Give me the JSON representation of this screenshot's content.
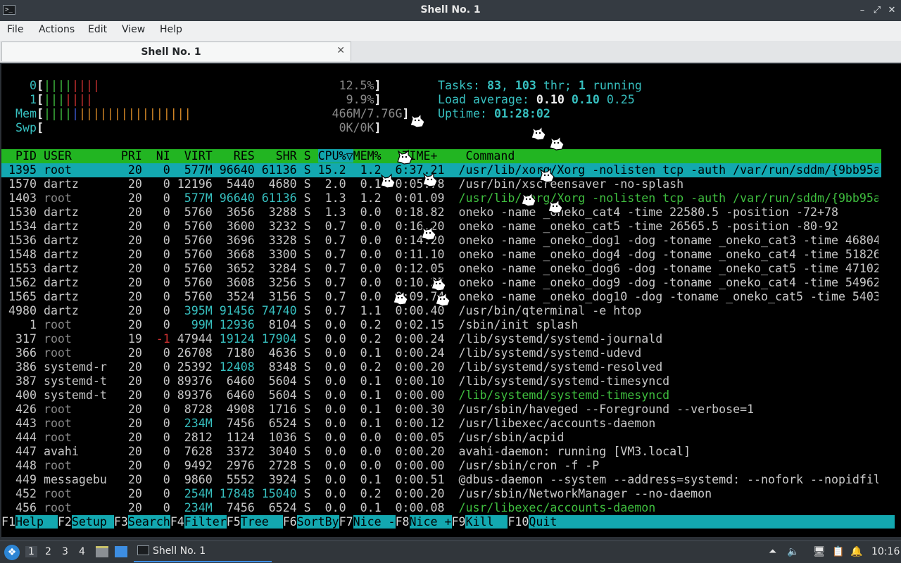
{
  "window": {
    "title": "Shell No. 1",
    "icon": "terminal-icon"
  },
  "menu": [
    "File",
    "Actions",
    "Edit",
    "View",
    "Help"
  ],
  "tab": {
    "label": "Shell No. 1"
  },
  "meters": {
    "cpu0": {
      "label": "0",
      "percent": "12.5%"
    },
    "cpu1": {
      "label": "1",
      "percent": "9.9%"
    },
    "mem": {
      "label": "Mem",
      "value": "466M/7.76G"
    },
    "swp": {
      "label": "Swp",
      "value": "0K/0K"
    }
  },
  "stats": {
    "tasks_label": "Tasks:",
    "tasks": "83",
    "threads": "103",
    "thr_label": "thr;",
    "running": "1",
    "running_label": "running",
    "load_label": "Load average:",
    "load1": "0.10",
    "load5": "0.10",
    "load15": "0.25",
    "uptime_label": "Uptime:",
    "uptime": "01:28:02"
  },
  "table": {
    "headers": [
      "PID",
      "USER",
      "PRI",
      "NI",
      "VIRT",
      "RES",
      "SHR",
      "S",
      "CPU%▽",
      "MEM%",
      "TIME+",
      "Command"
    ],
    "rows": [
      {
        "pid": "1395",
        "user": "root",
        "pri": "20",
        "ni": "0",
        "virt": "577M",
        "res": "96640",
        "shr": "61136",
        "s": "S",
        "cpu": "15.2",
        "mem": "1.2",
        "time": "6:37.21",
        "cmd": "/usr/lib/xorg/Xorg -nolisten tcp -auth /var/run/sddm/{9bb95a"
      },
      {
        "pid": "1570",
        "user": "dartz",
        "pri": "20",
        "ni": "0",
        "virt": "12196",
        "res": "5440",
        "shr": "4680",
        "s": "S",
        "cpu": "2.0",
        "mem": "0.1",
        "time": "0:05.78",
        "cmd": "/usr/bin/xscreensaver -no-splash"
      },
      {
        "pid": "1403",
        "user": "root",
        "pri": "20",
        "ni": "0",
        "virt": "577M",
        "res": "96640",
        "shr": "61136",
        "s": "S",
        "cpu": "1.3",
        "mem": "1.2",
        "time": "0:01.09",
        "cmd": "/usr/lib/xorg/Xorg -nolisten tcp -auth /var/run/sddm/{9bb95a"
      },
      {
        "pid": "1530",
        "user": "dartz",
        "pri": "20",
        "ni": "0",
        "virt": "5760",
        "res": "3656",
        "shr": "3288",
        "s": "S",
        "cpu": "1.3",
        "mem": "0.0",
        "time": "0:18.82",
        "cmd": "oneko -name _oneko_cat4 -time 22580.5 -position -72+78"
      },
      {
        "pid": "1534",
        "user": "dartz",
        "pri": "20",
        "ni": "0",
        "virt": "5760",
        "res": "3600",
        "shr": "3232",
        "s": "S",
        "cpu": "0.7",
        "mem": "0.0",
        "time": "0:16.20",
        "cmd": "oneko -name _oneko_cat5 -time 26565.5 -position -80-92"
      },
      {
        "pid": "1536",
        "user": "dartz",
        "pri": "20",
        "ni": "0",
        "virt": "5760",
        "res": "3696",
        "shr": "3328",
        "s": "S",
        "cpu": "0.7",
        "mem": "0.0",
        "time": "0:14.20",
        "cmd": "oneko -name _oneko_dog1 -dog -toname _oneko_cat3 -time 46804"
      },
      {
        "pid": "1548",
        "user": "dartz",
        "pri": "20",
        "ni": "0",
        "virt": "5760",
        "res": "3668",
        "shr": "3300",
        "s": "S",
        "cpu": "0.7",
        "mem": "0.0",
        "time": "0:11.10",
        "cmd": "oneko -name _oneko_dog4 -dog -toname _oneko_cat4 -time 51826"
      },
      {
        "pid": "1553",
        "user": "dartz",
        "pri": "20",
        "ni": "0",
        "virt": "5760",
        "res": "3652",
        "shr": "3284",
        "s": "S",
        "cpu": "0.7",
        "mem": "0.0",
        "time": "0:12.05",
        "cmd": "oneko -name _oneko_dog6 -dog -toname _oneko_cat5 -time 47102"
      },
      {
        "pid": "1562",
        "user": "dartz",
        "pri": "20",
        "ni": "0",
        "virt": "5760",
        "res": "3608",
        "shr": "3256",
        "s": "S",
        "cpu": "0.7",
        "mem": "0.0",
        "time": "0:10.25",
        "cmd": "oneko -name _oneko_dog9 -dog -toname _oneko_cat4 -time 54962"
      },
      {
        "pid": "1565",
        "user": "dartz",
        "pri": "20",
        "ni": "0",
        "virt": "5760",
        "res": "3524",
        "shr": "3156",
        "s": "S",
        "cpu": "0.7",
        "mem": "0.0",
        "time": "0:09.74",
        "cmd": "oneko -name _oneko_dog10 -dog -toname _oneko_cat5 -time 5403"
      },
      {
        "pid": "4980",
        "user": "dartz",
        "pri": "20",
        "ni": "0",
        "virt": "395M",
        "res": "91456",
        "shr": "74740",
        "s": "S",
        "cpu": "0.7",
        "mem": "1.1",
        "time": "0:00.40",
        "cmd": "/usr/bin/qterminal -e htop"
      },
      {
        "pid": "1",
        "user": "root",
        "pri": "20",
        "ni": "0",
        "virt": "99M",
        "res": "12936",
        "shr": "8104",
        "s": "S",
        "cpu": "0.0",
        "mem": "0.2",
        "time": "0:02.15",
        "cmd": "/sbin/init splash"
      },
      {
        "pid": "317",
        "user": "root",
        "pri": "19",
        "ni": "-1",
        "virt": "47944",
        "res": "19124",
        "shr": "17904",
        "s": "S",
        "cpu": "0.0",
        "mem": "0.2",
        "time": "0:00.24",
        "cmd": "/lib/systemd/systemd-journald"
      },
      {
        "pid": "366",
        "user": "root",
        "pri": "20",
        "ni": "0",
        "virt": "26708",
        "res": "7180",
        "shr": "4636",
        "s": "S",
        "cpu": "0.0",
        "mem": "0.1",
        "time": "0:00.24",
        "cmd": "/lib/systemd/systemd-udevd"
      },
      {
        "pid": "386",
        "user": "systemd-r",
        "pri": "20",
        "ni": "0",
        "virt": "25392",
        "res": "12408",
        "shr": "8348",
        "s": "S",
        "cpu": "0.0",
        "mem": "0.2",
        "time": "0:00.20",
        "cmd": "/lib/systemd/systemd-resolved"
      },
      {
        "pid": "387",
        "user": "systemd-t",
        "pri": "20",
        "ni": "0",
        "virt": "89376",
        "res": "6460",
        "shr": "5604",
        "s": "S",
        "cpu": "0.0",
        "mem": "0.1",
        "time": "0:00.10",
        "cmd": "/lib/systemd/systemd-timesyncd"
      },
      {
        "pid": "400",
        "user": "systemd-t",
        "pri": "20",
        "ni": "0",
        "virt": "89376",
        "res": "6460",
        "shr": "5604",
        "s": "S",
        "cpu": "0.0",
        "mem": "0.1",
        "time": "0:00.00",
        "cmd": "/lib/systemd/systemd-timesyncd"
      },
      {
        "pid": "426",
        "user": "root",
        "pri": "20",
        "ni": "0",
        "virt": "8728",
        "res": "4908",
        "shr": "1716",
        "s": "S",
        "cpu": "0.0",
        "mem": "0.1",
        "time": "0:00.30",
        "cmd": "/usr/sbin/haveged --Foreground --verbose=1"
      },
      {
        "pid": "443",
        "user": "root",
        "pri": "20",
        "ni": "0",
        "virt": "234M",
        "res": "7456",
        "shr": "6524",
        "s": "S",
        "cpu": "0.0",
        "mem": "0.1",
        "time": "0:00.12",
        "cmd": "/usr/libexec/accounts-daemon"
      },
      {
        "pid": "444",
        "user": "root",
        "pri": "20",
        "ni": "0",
        "virt": "2812",
        "res": "1124",
        "shr": "1036",
        "s": "S",
        "cpu": "0.0",
        "mem": "0.0",
        "time": "0:00.05",
        "cmd": "/usr/sbin/acpid"
      },
      {
        "pid": "447",
        "user": "avahi",
        "pri": "20",
        "ni": "0",
        "virt": "7628",
        "res": "3372",
        "shr": "3040",
        "s": "S",
        "cpu": "0.0",
        "mem": "0.0",
        "time": "0:00.20",
        "cmd": "avahi-daemon: running [VM3.local]"
      },
      {
        "pid": "448",
        "user": "root",
        "pri": "20",
        "ni": "0",
        "virt": "9492",
        "res": "2976",
        "shr": "2728",
        "s": "S",
        "cpu": "0.0",
        "mem": "0.0",
        "time": "0:00.00",
        "cmd": "/usr/sbin/cron -f -P"
      },
      {
        "pid": "449",
        "user": "messagebu",
        "pri": "20",
        "ni": "0",
        "virt": "9860",
        "res": "5552",
        "shr": "3924",
        "s": "S",
        "cpu": "0.0",
        "mem": "0.1",
        "time": "0:00.51",
        "cmd": "@dbus-daemon --system --address=systemd: --nofork --nopidfil"
      },
      {
        "pid": "452",
        "user": "root",
        "pri": "20",
        "ni": "0",
        "virt": "254M",
        "res": "17848",
        "shr": "15040",
        "s": "S",
        "cpu": "0.0",
        "mem": "0.2",
        "time": "0:00.20",
        "cmd": "/usr/sbin/NetworkManager --no-daemon"
      },
      {
        "pid": "456",
        "user": "root",
        "pri": "20",
        "ni": "0",
        "virt": "234M",
        "res": "7456",
        "shr": "6524",
        "s": "S",
        "cpu": "0.0",
        "mem": "0.1",
        "time": "0:00.08",
        "cmd": "/usr/libexec/accounts-daemon"
      }
    ]
  },
  "fkeys": [
    {
      "key": "F1",
      "label": "Help  "
    },
    {
      "key": "F2",
      "label": "Setup "
    },
    {
      "key": "F3",
      "label": "Search"
    },
    {
      "key": "F4",
      "label": "Filter"
    },
    {
      "key": "F5",
      "label": "Tree  "
    },
    {
      "key": "F6",
      "label": "SortBy"
    },
    {
      "key": "F7",
      "label": "Nice -"
    },
    {
      "key": "F8",
      "label": "Nice +"
    },
    {
      "key": "F9",
      "label": "Kill  "
    },
    {
      "key": "F10",
      "label": "Quit"
    }
  ],
  "taskbar": {
    "workspaces": [
      "1",
      "2",
      "3",
      "4"
    ],
    "task_label": "Shell No. 1",
    "clock": "10:16"
  },
  "colors": {
    "header_green": "#22b522",
    "selection_cyan": "#13a8b0",
    "taskbar": "#31363b"
  }
}
